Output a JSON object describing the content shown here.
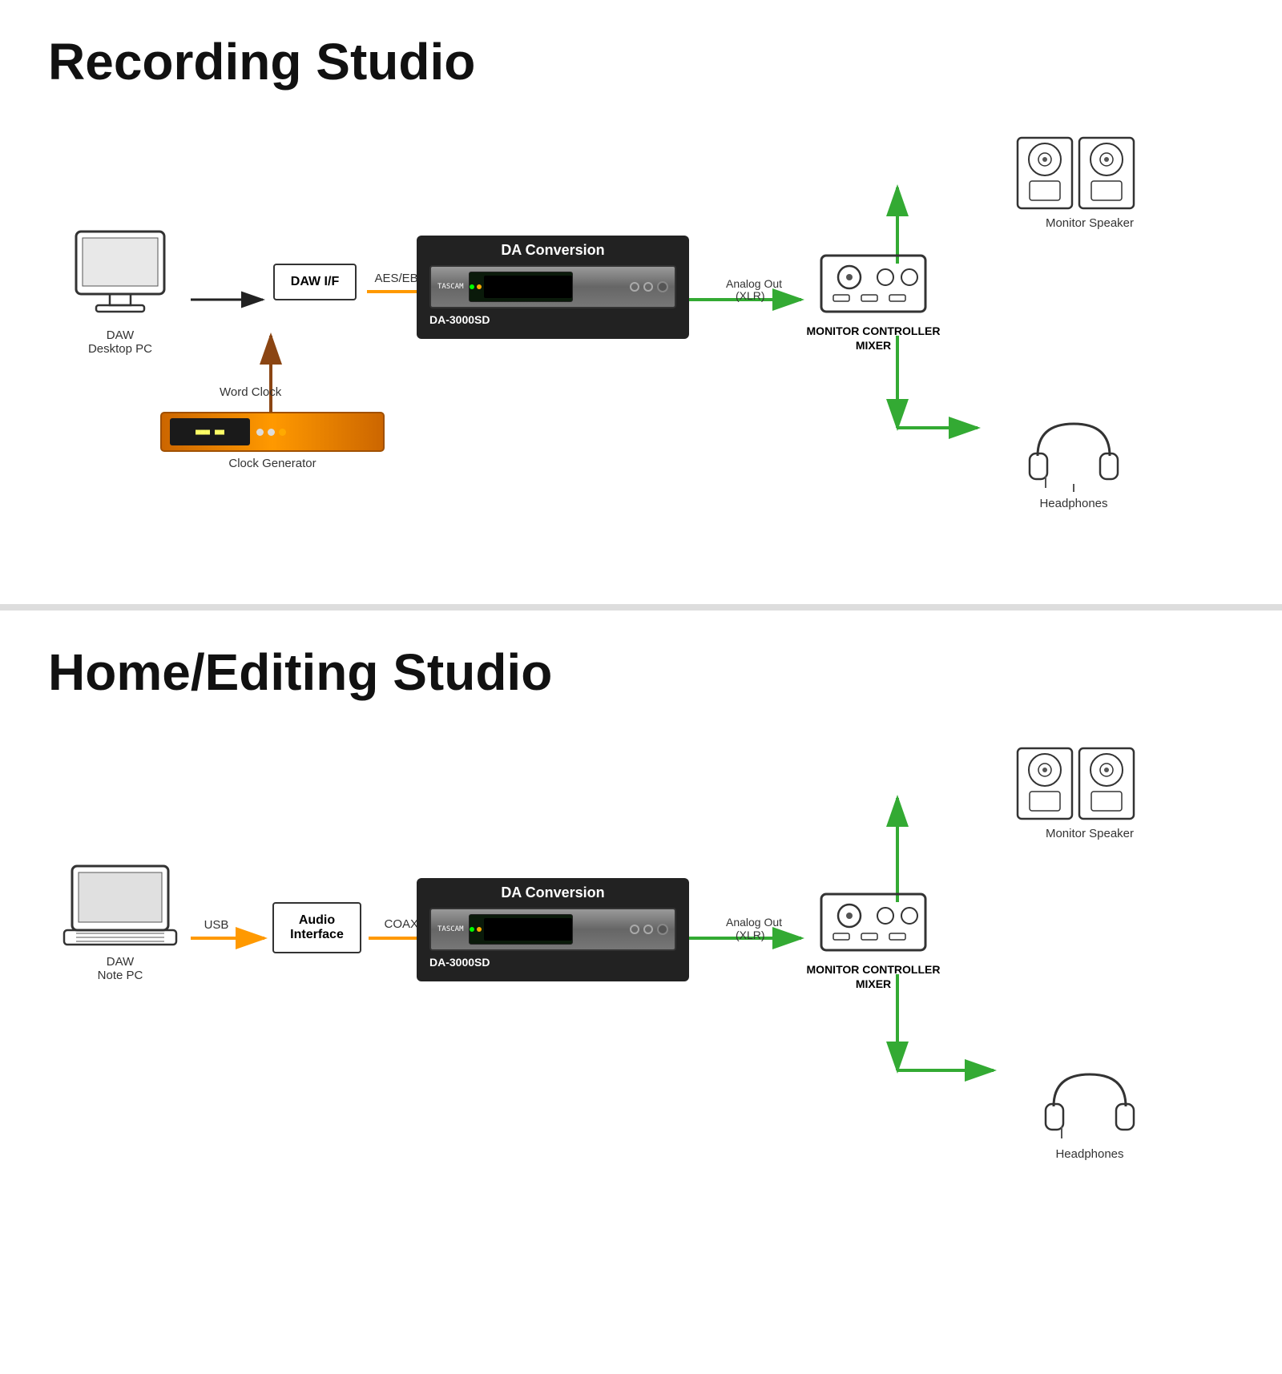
{
  "section1": {
    "title": "Recording Studio",
    "components": {
      "daw_pc": {
        "line1": "DAW",
        "line2": "Desktop PC"
      },
      "daw_if": {
        "label": "DAW I/F"
      },
      "da_conversion": {
        "title": "DA Conversion",
        "device": "DA-3000SD"
      },
      "clock_gen": {
        "label": "Clock Generator"
      },
      "monitor_ctrl": {
        "line1": "MONITOR CONTROLLER",
        "line2": "MIXER"
      },
      "monitor_speaker": {
        "label": "Monitor Speaker"
      },
      "headphones": {
        "label": "Headphones"
      }
    },
    "arrows": {
      "daw_to_dawif": "",
      "dawif_to_da": {
        "label": "AES/EBU"
      },
      "da_to_ctrl": {
        "label": "Analog Out\n(XLR)"
      },
      "ctrl_to_speaker": "",
      "ctrl_to_headphones": "",
      "clockgen_to_dawif": {
        "label": "Word Clock"
      }
    }
  },
  "section2": {
    "title": "Home/Editing Studio",
    "components": {
      "daw_pc": {
        "line1": "DAW",
        "line2": "Note PC"
      },
      "audio_if": {
        "line1": "Audio",
        "line2": "Interface"
      },
      "da_conversion": {
        "title": "DA Conversion",
        "device": "DA-3000SD"
      },
      "monitor_ctrl": {
        "line1": "MONITOR CONTROLLER",
        "line2": "MIXER"
      },
      "monitor_speaker": {
        "label": "Monitor Speaker"
      },
      "headphones": {
        "label": "Headphones"
      }
    },
    "arrows": {
      "daw_to_audioif": {
        "label": "USB"
      },
      "audioif_to_da": {
        "label": "COAXIAL"
      },
      "da_to_ctrl": {
        "label": "Analog Out\n(XLR)"
      },
      "ctrl_to_speaker": "",
      "ctrl_to_headphones": ""
    }
  }
}
